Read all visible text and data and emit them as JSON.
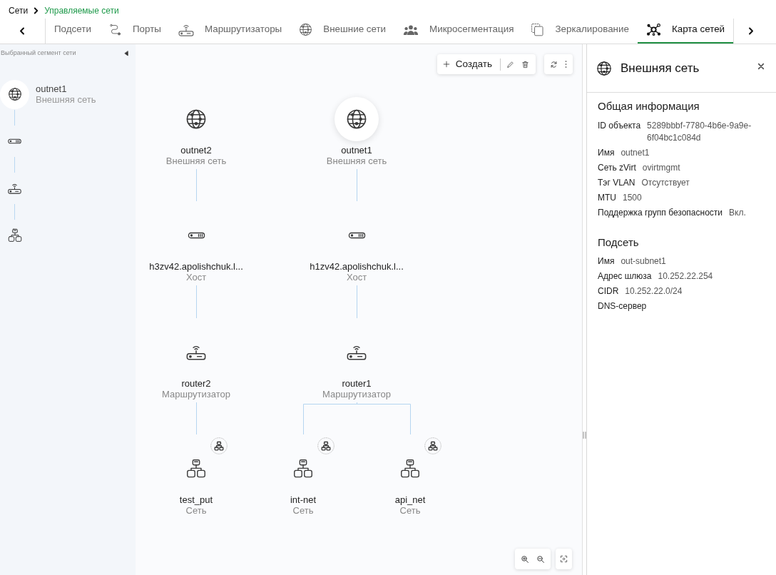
{
  "breadcrumb": [
    {
      "label": "Сети",
      "selected": false
    },
    {
      "label": "Управляемые сети",
      "selected": true
    }
  ],
  "tabs": [
    {
      "label": "Подсети",
      "kind": "subnets",
      "selected": false
    },
    {
      "label": "Порты",
      "kind": "ports",
      "selected": false
    },
    {
      "label": "Маршрутизаторы",
      "kind": "routers",
      "selected": false
    },
    {
      "label": "Внешние сети",
      "kind": "external",
      "selected": false
    },
    {
      "label": "Микросегментация",
      "kind": "microsegmentation",
      "selected": false
    },
    {
      "label": "Зеркалирование",
      "kind": "mirroring",
      "selected": false
    },
    {
      "label": "Карта сетей",
      "kind": "map",
      "selected": true
    }
  ],
  "segment_panel": {
    "title": "Выбранный сегмент сети",
    "items": [
      {
        "kind": "external",
        "name": "outnet1",
        "type": "Внешняя сеть",
        "selected": true
      },
      {
        "kind": "host",
        "selected": false
      },
      {
        "kind": "router",
        "selected": false
      },
      {
        "kind": "network",
        "selected": false
      }
    ]
  },
  "toolbar": {
    "create_label": "Создать"
  },
  "map": {
    "nodes": [
      {
        "kind": "external",
        "name": "outnet2",
        "type": "Внешняя сеть",
        "selected": false,
        "children": [
          {
            "kind": "host",
            "name": "h3zv42.apolishchuk.l...",
            "type": "Хост",
            "selected": false,
            "children": [
              {
                "kind": "router",
                "name": "router2",
                "type": "Маршрутизатор",
                "selected": false,
                "children": [
                  {
                    "kind": "network",
                    "name": "test_put",
                    "type": "Сеть",
                    "selected": false
                  }
                ]
              }
            ]
          }
        ]
      },
      {
        "kind": "external",
        "name": "outnet1",
        "type": "Внешняя сеть",
        "selected": true,
        "children": [
          {
            "kind": "host",
            "name": "h1zv42.apolishchuk.l...",
            "type": "Хост",
            "selected": false,
            "children": [
              {
                "kind": "router",
                "name": "router1",
                "type": "Маршрутизатор",
                "selected": false,
                "children": [
                  {
                    "kind": "network",
                    "name": "int-net",
                    "type": "Сеть",
                    "selected": false
                  },
                  {
                    "kind": "network",
                    "name": "api_net",
                    "type": "Сеть",
                    "selected": false
                  }
                ]
              }
            ]
          }
        ]
      }
    ]
  },
  "details": {
    "title": "Внешняя сеть",
    "sections": [
      {
        "title": "Общая информация",
        "fields": [
          {
            "label": "ID объекта",
            "value": "5289bbbf-7780-4b6e-9a9e-6f04bc1c084d"
          },
          {
            "label": "Имя",
            "value": "outnet1"
          },
          {
            "label": "Сеть zVirt",
            "value": "ovirtmgmt"
          },
          {
            "label": "Тэг VLAN",
            "value": "Отсутствует"
          },
          {
            "label": "MTU",
            "value": "1500"
          },
          {
            "label": "Поддержка групп безопасности",
            "value": "Вкл."
          }
        ]
      },
      {
        "title": "Подсеть",
        "fields": [
          {
            "label": "Имя",
            "value": "out-subnet1"
          },
          {
            "label": "Адрес шлюза",
            "value": "10.252.22.254"
          },
          {
            "label": "CIDR",
            "value": "10.252.22.0/24"
          },
          {
            "label": "DNS-сервер"
          }
        ]
      }
    ]
  }
}
